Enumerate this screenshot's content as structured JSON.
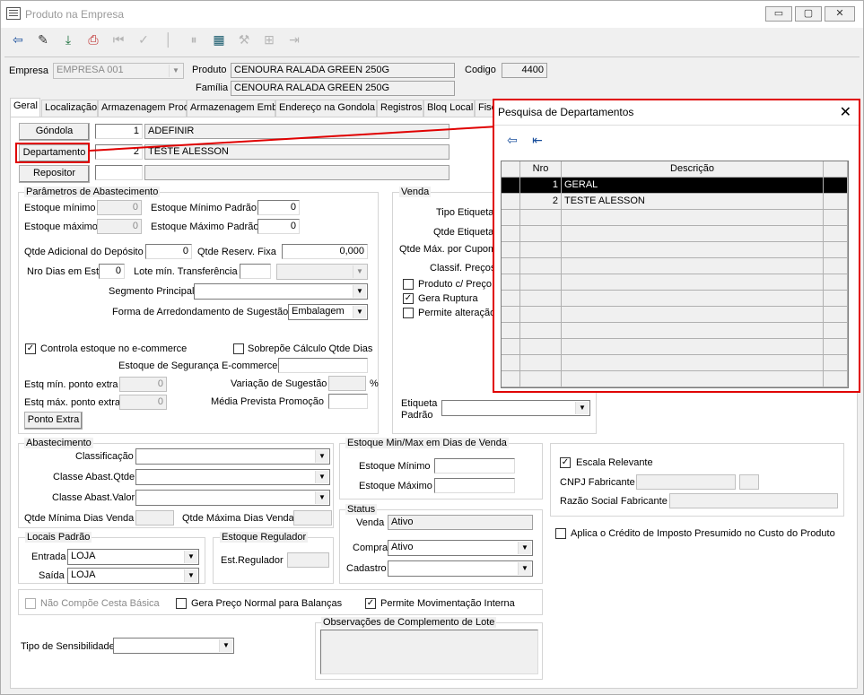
{
  "window": {
    "title": "Produto na Empresa",
    "min": "▭",
    "max": "▢",
    "close": "✕"
  },
  "header": {
    "empresa_label": "Empresa",
    "empresa_value": "EMPRESA 001",
    "produto_label": "Produto",
    "produto_value": "CENOURA RALADA GREEN 250G",
    "codigo_label": "Codigo",
    "codigo_value": "4400",
    "familia_label": "Família",
    "familia_value": "CENOURA RALADA GREEN 250G"
  },
  "tabs": [
    "Geral",
    "Localização",
    "Armazenagem Prod",
    "Armazenagem Emb",
    "Endereço na Gondola",
    "Registros",
    "Bloq Local",
    "Fisc"
  ],
  "top": {
    "gondola_btn": "Góndola",
    "gondola_nro": "1",
    "gondola_desc": "ADEFINIR",
    "departamento_btn": "Departamento",
    "departamento_nro": "2",
    "departamento_desc": "TESTE ALESSON",
    "repositor_btn": "Repositor"
  },
  "abast": {
    "title": "Parâmetros de Abastecimento",
    "est_min_label": "Estoque mínimo",
    "est_min": "0",
    "est_min_padrao_label": "Estoque Mínimo Padrão",
    "est_min_padrao": "0",
    "est_max_label": "Estoque máximo",
    "est_max": "0",
    "est_max_padrao_label": "Estoque Máximo Padrão",
    "est_max_padrao": "0",
    "qtde_adic_label": "Qtde Adicional do Depósito",
    "qtde_adic": "0",
    "qtde_reserv_label": "Qtde Reserv. Fixa",
    "qtde_reserv": "0,000",
    "nro_dias_label": "Nro Dias em Est.",
    "nro_dias": "0",
    "lote_label": "Lote mín. Transferência",
    "segmento_label": "Segmento Principal",
    "forma_label": "Forma de Arredondamento de Sugestão",
    "forma_value": "Embalagem",
    "controla_label": "Controla estoque no e-commerce",
    "sobrepoe_label": "Sobrepõe Cálculo Qtde Dias",
    "seg_ecom_label": "Estoque de Segurança E-commerce",
    "estq_min_pe_label": "Estq mín. ponto extra",
    "estq_min_pe": "0",
    "variacao_label": "Variação de Sugestão",
    "percent": "%",
    "estq_max_pe_label": "Estq máx. ponto extra",
    "estq_max_pe": "0",
    "media_label": "Média Prevista Promoção",
    "ponto_extra_btn": "Ponto Extra"
  },
  "venda": {
    "title": "Venda",
    "tipo_etiqueta": "Tipo Etiqueta",
    "qtde_etiqueta": "Qtde Etiqueta",
    "qtde_max_cupom": "Qtde Máx. por Cupom",
    "classif_precos": "Classif. Preços",
    "produto_c_preco": "Produto c/ Preço",
    "gera_ruptura": "Gera Ruptura",
    "permite_alteracao": "Permite alteração",
    "etiqueta_padrao_1": "Etiqueta",
    "etiqueta_padrao_2": "Padrão"
  },
  "abastecimento": {
    "title": "Abastecimento",
    "classificacao": "Classificação",
    "classe_qtde": "Classe Abast.Qtde",
    "classe_valor": "Classe Abast.Valor",
    "qtde_min_dias": "Qtde Mínima Dias Venda",
    "qtde_max_dias": "Qtde Máxima Dias Venda"
  },
  "minmax": {
    "title": "Estoque Min/Max em Dias de Venda",
    "minimo": "Estoque Mínimo",
    "maximo": "Estoque Máximo"
  },
  "status": {
    "title": "Status",
    "venda_label": "Venda",
    "venda_value": "Ativo",
    "compra_label": "Compra",
    "compra_value": "Ativo",
    "cadastro_label": "Cadastro"
  },
  "fabricante": {
    "escala": "Escala Relevante",
    "cnpj": "CNPJ Fabricante",
    "razao": "Razão Social Fabricante",
    "aplica": "Aplica o Crédito de Imposto Presumido no Custo do Produto"
  },
  "locais": {
    "title": "Locais Padrão",
    "entrada_label": "Entrada",
    "entrada_value": "LOJA",
    "saida_label": "Saída",
    "saida_value": "LOJA"
  },
  "regulador": {
    "title": "Estoque Regulador",
    "label": "Est.Regulador"
  },
  "bottom": {
    "nao_compoe": "Não Compõe Cesta Básica",
    "gera_preco": "Gera Preço Normal para Balanças",
    "permite_mov": "Permite Movimentação Interna",
    "tipo_sens": "Tipo de Sensibilidade",
    "obs_title": "Observações de Complemento de Lote"
  },
  "dialog": {
    "title": "Pesquisa de Departamentos",
    "close": "✕",
    "col_nro": "Nro",
    "col_desc": "Descrição",
    "rows": [
      {
        "nro": "1",
        "desc": "GERAL"
      },
      {
        "nro": "2",
        "desc": "TESTE ALESSON"
      }
    ]
  }
}
